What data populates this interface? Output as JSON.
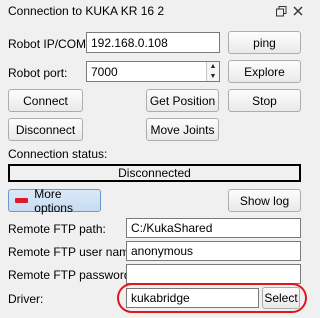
{
  "window": {
    "title": "Connection to KUKA KR 16 2",
    "restore_icon": "restore-icon",
    "close_icon": "close-icon"
  },
  "robot_ip": {
    "label": "Robot IP/COM:",
    "value": "192.168.0.108",
    "ping_label": "ping"
  },
  "robot_port": {
    "label": "Robot port:",
    "value": "7000",
    "explore_label": "Explore"
  },
  "actions": {
    "connect": "Connect",
    "get_position": "Get Position",
    "stop": "Stop",
    "disconnect": "Disconnect",
    "move_joints": "Move Joints"
  },
  "status": {
    "label": "Connection status:",
    "value": "Disconnected"
  },
  "more_options": {
    "label": "More options",
    "show_log": "Show log"
  },
  "ftp": {
    "path_label": "Remote FTP path:",
    "path_value": "C:/KukaShared",
    "user_label": "Remote FTP user name:",
    "user_value": "anonymous",
    "password_label": "Remote FTP password:",
    "password_value": ""
  },
  "driver": {
    "label": "Driver:",
    "value": "kukabridge",
    "select_label": "Select"
  },
  "colors": {
    "minus_red": "#e0182d",
    "highlight_red": "#e0161f",
    "more_button_blue": "#c7dcf1"
  }
}
